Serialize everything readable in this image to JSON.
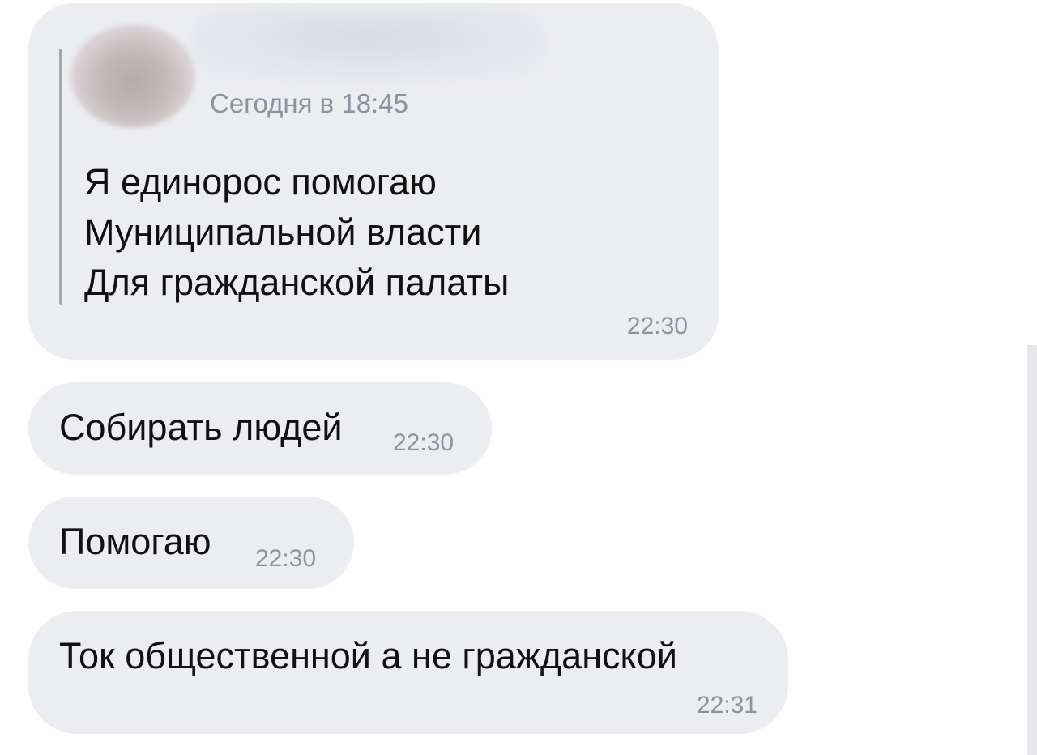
{
  "forwarded": {
    "date": "Сегодня в 18:45",
    "lines": [
      "Я единорос помогаю",
      "Муниципальной власти",
      "Для гражданской палаты"
    ],
    "time": "22:30"
  },
  "messages": [
    {
      "text": "Собирать людей",
      "time": "22:30"
    },
    {
      "text": "Помогаю",
      "time": "22:30"
    },
    {
      "text": "Ток общественной а не гражданской",
      "time": "22:31"
    }
  ]
}
